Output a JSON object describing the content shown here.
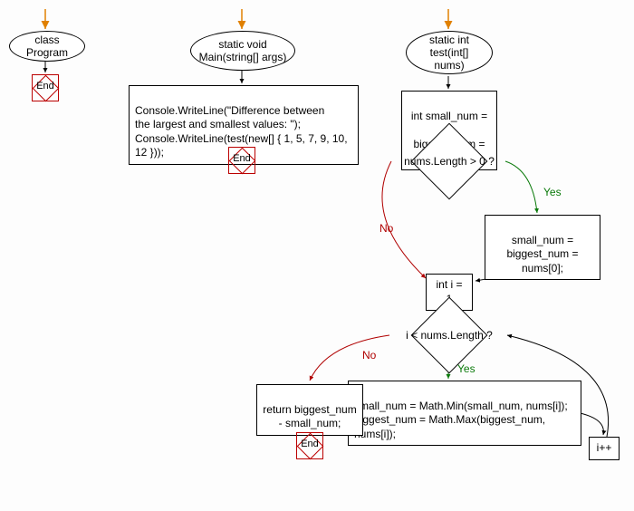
{
  "flowchart": {
    "class_node": "class Program",
    "main_node": "static void\nMain(string[] args)",
    "main_body": "Console.WriteLine(\"Difference between\nthe largest and smallest values: \");\nConsole.WriteLine(test(new[] { 1, 5, 7, 9, 10, 12 }));",
    "test_node": "static int\ntest(int[] nums)",
    "init_vars": "int small_num = 0,\nbiggest_num = 0;",
    "cond1": "nums.Length > 0 ?",
    "assign_first": "small_num =\nbiggest_num = nums[0];",
    "init_i": "int i = 1",
    "cond2": "i < nums.Length ?",
    "loop_body": "small_num = Math.Min(small_num, nums[i]);\nbiggest_num = Math.Max(biggest_num, nums[i]);",
    "increment": "i++",
    "return_stmt": "return biggest_num\n- small_num;",
    "end_label": "End",
    "yes_label": "Yes",
    "no_label": "No"
  }
}
